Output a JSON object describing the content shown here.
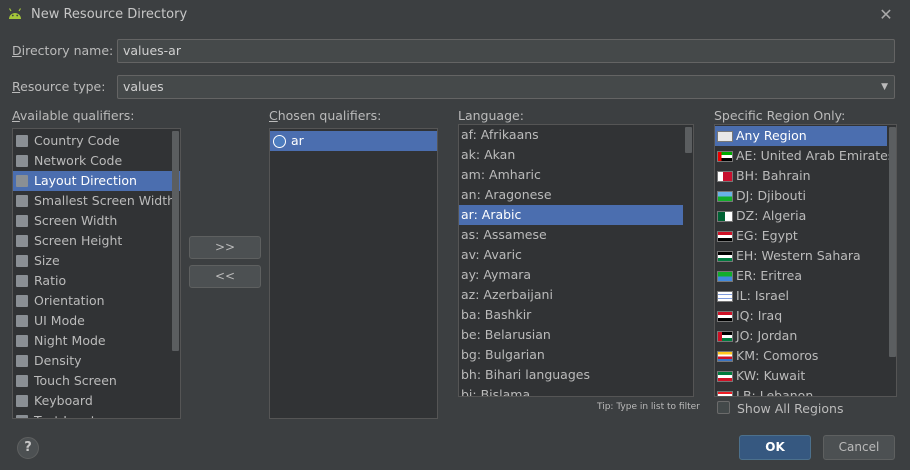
{
  "window": {
    "title": "New Resource Directory",
    "close_icon": "✕"
  },
  "form": {
    "directory_name_label_prefix": "D",
    "directory_name_label_rest": "irectory name:",
    "directory_name_value": "values-ar",
    "resource_type_label_prefix": "R",
    "resource_type_label_rest": "esource type:",
    "resource_type_value": "values",
    "combo_arrow": "▼"
  },
  "available": {
    "label_prefix": "A",
    "label_rest": "vailable qualifiers:",
    "items": [
      {
        "label": "Country Code",
        "icon": "flag-icon",
        "selected": false
      },
      {
        "label": "Network Code",
        "icon": "network-icon",
        "selected": false
      },
      {
        "label": "Layout Direction",
        "icon": "layout-direction-icon",
        "selected": true
      },
      {
        "label": "Smallest Screen Width",
        "icon": "screen-width-icon",
        "selected": false
      },
      {
        "label": "Screen Width",
        "icon": "screen-width-icon",
        "selected": false
      },
      {
        "label": "Screen Height",
        "icon": "screen-height-icon",
        "selected": false
      },
      {
        "label": "Size",
        "icon": "size-icon",
        "selected": false
      },
      {
        "label": "Ratio",
        "icon": "ratio-icon",
        "selected": false
      },
      {
        "label": "Orientation",
        "icon": "orientation-icon",
        "selected": false
      },
      {
        "label": "UI Mode",
        "icon": "ui-mode-icon",
        "selected": false
      },
      {
        "label": "Night Mode",
        "icon": "night-mode-icon",
        "selected": false
      },
      {
        "label": "Density",
        "icon": "density-icon",
        "selected": false
      },
      {
        "label": "Touch Screen",
        "icon": "touch-screen-icon",
        "selected": false
      },
      {
        "label": "Keyboard",
        "icon": "keyboard-icon",
        "selected": false
      },
      {
        "label": "Text Input",
        "icon": "text-input-icon",
        "selected": false
      }
    ]
  },
  "chosen": {
    "label_prefix": "C",
    "label_rest": "hosen qualifiers:",
    "items": [
      {
        "label": "ar",
        "icon": "globe-icon",
        "selected": true
      }
    ]
  },
  "buttons": {
    "add": ">>",
    "remove": "<<",
    "ok": "OK",
    "cancel": "Cancel",
    "help": "?"
  },
  "language": {
    "label": "Language:",
    "items": [
      {
        "label": "af: Afrikaans",
        "selected": false
      },
      {
        "label": "ak: Akan",
        "selected": false
      },
      {
        "label": "am: Amharic",
        "selected": false
      },
      {
        "label": "an: Aragonese",
        "selected": false
      },
      {
        "label": "ar: Arabic",
        "selected": true
      },
      {
        "label": "as: Assamese",
        "selected": false
      },
      {
        "label": "av: Avaric",
        "selected": false
      },
      {
        "label": "ay: Aymara",
        "selected": false
      },
      {
        "label": "az: Azerbaijani",
        "selected": false
      },
      {
        "label": "ba: Bashkir",
        "selected": false
      },
      {
        "label": "be: Belarusian",
        "selected": false
      },
      {
        "label": "bg: Bulgarian",
        "selected": false
      },
      {
        "label": "bh: Bihari languages",
        "selected": false
      },
      {
        "label": "bi: Bislama",
        "selected": false
      }
    ],
    "tip": "Tip: Type in list to filter"
  },
  "region": {
    "label": "Specific Region Only:",
    "items": [
      {
        "label": "Any Region",
        "flag": "none",
        "selected": true
      },
      {
        "label": "AE: United Arab Emirates",
        "flag": "ae",
        "selected": false
      },
      {
        "label": "BH: Bahrain",
        "flag": "bh",
        "selected": false
      },
      {
        "label": "DJ: Djibouti",
        "flag": "dj",
        "selected": false
      },
      {
        "label": "DZ: Algeria",
        "flag": "dz",
        "selected": false
      },
      {
        "label": "EG: Egypt",
        "flag": "eg",
        "selected": false
      },
      {
        "label": "EH: Western Sahara",
        "flag": "eh",
        "selected": false
      },
      {
        "label": "ER: Eritrea",
        "flag": "er",
        "selected": false
      },
      {
        "label": "IL: Israel",
        "flag": "il",
        "selected": false
      },
      {
        "label": "IQ: Iraq",
        "flag": "iq",
        "selected": false
      },
      {
        "label": "JO: Jordan",
        "flag": "jo",
        "selected": false
      },
      {
        "label": "KM: Comoros",
        "flag": "km",
        "selected": false
      },
      {
        "label": "KW: Kuwait",
        "flag": "kw",
        "selected": false
      },
      {
        "label": "LB: Lebanon",
        "flag": "lb",
        "selected": false
      }
    ],
    "show_all_label": "Show All Regions"
  },
  "colors": {
    "background": "#3c3f41",
    "selection": "#4b6eaf",
    "primary_button": "#365880",
    "android_green": "#a4c639"
  }
}
